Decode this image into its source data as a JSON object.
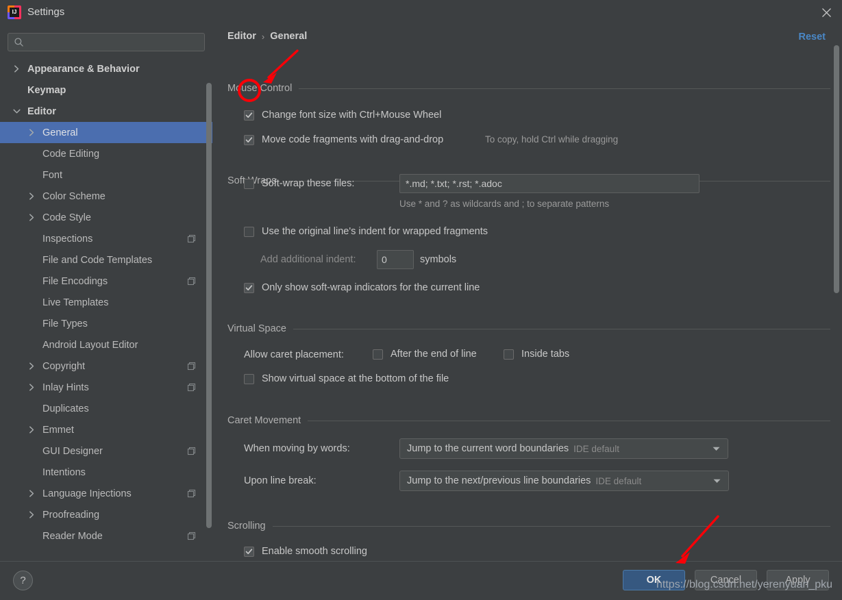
{
  "window": {
    "title": "Settings",
    "logo_text": "IJ",
    "close_icon": "close-icon"
  },
  "sidebar": {
    "search": {
      "value": "",
      "placeholder": ""
    },
    "items": [
      {
        "label": "Appearance & Behavior",
        "indent": 0,
        "twisty": "right",
        "bold": true,
        "selected": false,
        "copy": false
      },
      {
        "label": "Keymap",
        "indent": 0,
        "twisty": "none",
        "bold": true,
        "selected": false,
        "copy": false
      },
      {
        "label": "Editor",
        "indent": 0,
        "twisty": "down",
        "bold": true,
        "selected": false,
        "copy": false
      },
      {
        "label": "General",
        "indent": 1,
        "twisty": "right",
        "bold": false,
        "selected": true,
        "copy": false
      },
      {
        "label": "Code Editing",
        "indent": 1,
        "twisty": "none",
        "bold": false,
        "selected": false,
        "copy": false
      },
      {
        "label": "Font",
        "indent": 1,
        "twisty": "none",
        "bold": false,
        "selected": false,
        "copy": false
      },
      {
        "label": "Color Scheme",
        "indent": 1,
        "twisty": "right",
        "bold": false,
        "selected": false,
        "copy": false
      },
      {
        "label": "Code Style",
        "indent": 1,
        "twisty": "right",
        "bold": false,
        "selected": false,
        "copy": false
      },
      {
        "label": "Inspections",
        "indent": 1,
        "twisty": "none",
        "bold": false,
        "selected": false,
        "copy": true
      },
      {
        "label": "File and Code Templates",
        "indent": 1,
        "twisty": "none",
        "bold": false,
        "selected": false,
        "copy": false
      },
      {
        "label": "File Encodings",
        "indent": 1,
        "twisty": "none",
        "bold": false,
        "selected": false,
        "copy": true
      },
      {
        "label": "Live Templates",
        "indent": 1,
        "twisty": "none",
        "bold": false,
        "selected": false,
        "copy": false
      },
      {
        "label": "File Types",
        "indent": 1,
        "twisty": "none",
        "bold": false,
        "selected": false,
        "copy": false
      },
      {
        "label": "Android Layout Editor",
        "indent": 1,
        "twisty": "none",
        "bold": false,
        "selected": false,
        "copy": false
      },
      {
        "label": "Copyright",
        "indent": 1,
        "twisty": "right",
        "bold": false,
        "selected": false,
        "copy": true
      },
      {
        "label": "Inlay Hints",
        "indent": 1,
        "twisty": "right",
        "bold": false,
        "selected": false,
        "copy": true
      },
      {
        "label": "Duplicates",
        "indent": 1,
        "twisty": "none",
        "bold": false,
        "selected": false,
        "copy": false
      },
      {
        "label": "Emmet",
        "indent": 1,
        "twisty": "right",
        "bold": false,
        "selected": false,
        "copy": false
      },
      {
        "label": "GUI Designer",
        "indent": 1,
        "twisty": "none",
        "bold": false,
        "selected": false,
        "copy": true
      },
      {
        "label": "Intentions",
        "indent": 1,
        "twisty": "none",
        "bold": false,
        "selected": false,
        "copy": false
      },
      {
        "label": "Language Injections",
        "indent": 1,
        "twisty": "right",
        "bold": false,
        "selected": false,
        "copy": true
      },
      {
        "label": "Proofreading",
        "indent": 1,
        "twisty": "right",
        "bold": false,
        "selected": false,
        "copy": false
      },
      {
        "label": "Reader Mode",
        "indent": 1,
        "twisty": "none",
        "bold": false,
        "selected": false,
        "copy": true
      }
    ]
  },
  "content": {
    "breadcrumb": {
      "root": "Editor",
      "separator": "›",
      "leaf": "General"
    },
    "reset_label": "Reset",
    "sections": {
      "mouse_control": {
        "title": "Mouse Control",
        "change_font_size": {
          "label": "Change font size with Ctrl+Mouse Wheel",
          "checked": true
        },
        "move_fragments": {
          "label": "Move code fragments with drag-and-drop",
          "checked": true
        },
        "move_fragments_hint": "To copy, hold Ctrl while dragging"
      },
      "soft_wraps": {
        "title": "Soft Wraps",
        "soft_wrap_files": {
          "label": "Soft-wrap these files:",
          "checked": false
        },
        "soft_wrap_files_value": "*.md; *.txt; *.rst; *.adoc",
        "wildcard_hint": "Use * and ? as wildcards and ; to separate patterns",
        "original_indent": {
          "label": "Use the original line's indent for wrapped fragments",
          "checked": false
        },
        "add_indent_label": "Add additional indent:",
        "add_indent_value": "0",
        "symbols_label": "symbols",
        "only_show_indicators": {
          "label": "Only show soft-wrap indicators for the current line",
          "checked": true
        }
      },
      "virtual_space": {
        "title": "Virtual Space",
        "allow_caret_label": "Allow caret placement:",
        "after_end_of_line": {
          "label": "After the end of line",
          "checked": false
        },
        "inside_tabs": {
          "label": "Inside tabs",
          "checked": false
        },
        "show_virtual_space": {
          "label": "Show virtual space at the bottom of the file",
          "checked": false
        }
      },
      "caret_movement": {
        "title": "Caret Movement",
        "when_moving_label": "When moving by words:",
        "when_moving_value": "Jump to the current word boundaries",
        "when_moving_hint": "IDE default",
        "upon_line_break_label": "Upon line break:",
        "upon_line_break_value": "Jump to the next/previous line boundaries",
        "upon_line_break_hint": "IDE default"
      },
      "scrolling": {
        "title": "Scrolling",
        "smooth_scrolling": {
          "label": "Enable smooth scrolling",
          "checked": true
        }
      }
    }
  },
  "footer": {
    "help_label": "?",
    "ok_label": "OK",
    "cancel_label": "Cancel",
    "apply_label": "Apply"
  },
  "watermark": "https://blog.csdn.net/yerenyuan_pku",
  "annotations": {
    "highlight_color": "#fb0007",
    "arrow_to_checkbox": "red-arrow-icon",
    "oval_on_checkbox": "red-oval-highlight",
    "arrow_to_ok": "red-arrow-icon"
  },
  "colors": {
    "window_bg": "#3c3f41",
    "selection_blue": "#4b6eaf",
    "link_blue": "#4a88c7",
    "primary_button": "#365880",
    "annotation_red": "#fb0007"
  }
}
